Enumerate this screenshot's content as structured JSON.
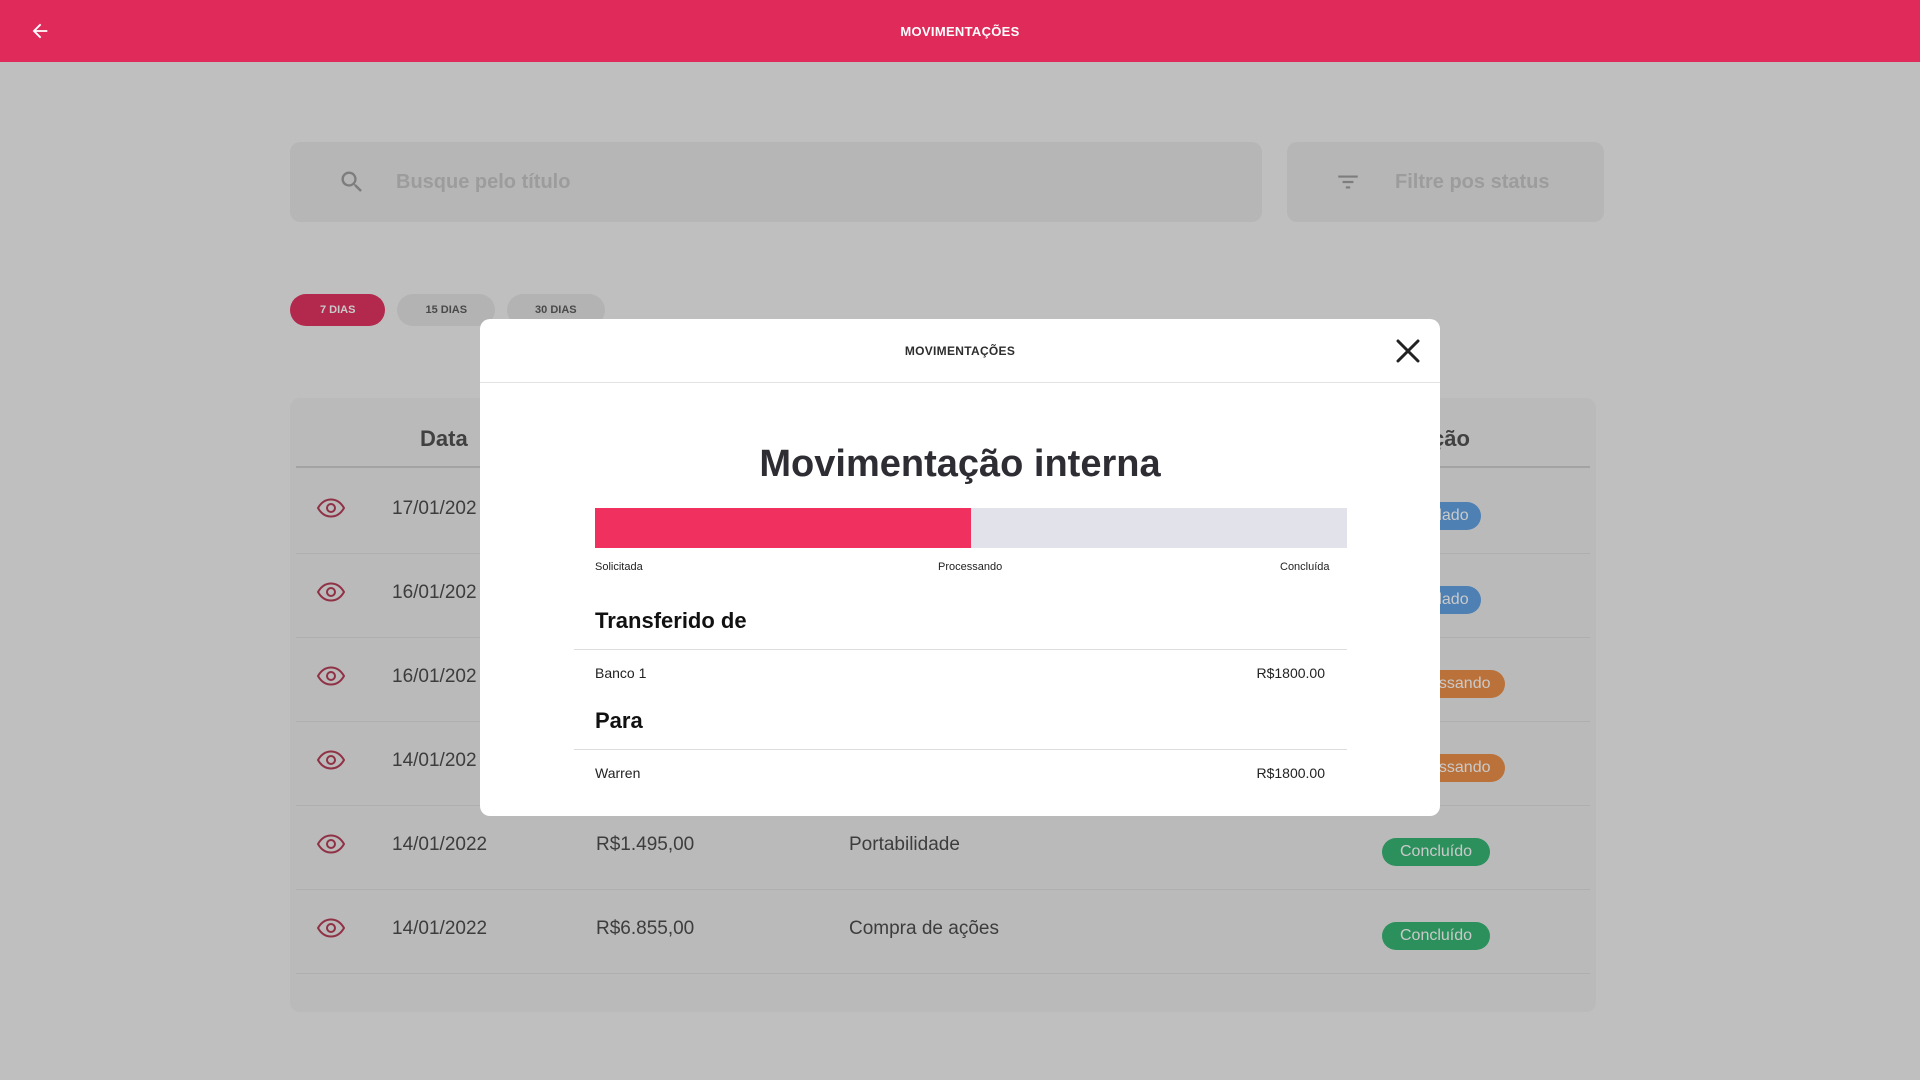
{
  "header": {
    "title": "MOVIMENTAÇÕES"
  },
  "search": {
    "placeholder": "Busque pelo título"
  },
  "status_filter": {
    "placeholder": "Filtre pos status"
  },
  "period_chips": [
    {
      "label": "7 DIAS",
      "active": true
    },
    {
      "label": "15 DIAS",
      "active": false
    },
    {
      "label": "30 DIAS",
      "active": false
    }
  ],
  "table": {
    "headers": {
      "date": "Data",
      "status": "ção"
    },
    "rows": [
      {
        "date": "17/01/202",
        "status": "dado",
        "status_color": "#5b9ee2"
      },
      {
        "date": "16/01/202",
        "status": "dado",
        "status_color": "#5b9ee2"
      },
      {
        "date": "16/01/202",
        "status": "essando",
        "status_color": "#ec8a40"
      },
      {
        "date": "14/01/202",
        "status": "essando",
        "status_color": "#ec8a40"
      },
      {
        "date": "14/01/2022",
        "value": "R$1.495,00",
        "description": "Portabilidade",
        "status": "Concluído",
        "status_color": "#2db36e"
      },
      {
        "date": "14/01/2022",
        "value": "R$6.855,00",
        "description": "Compra de ações",
        "status": "Concluído",
        "status_color": "#2db36e"
      }
    ]
  },
  "modal": {
    "header": "MOVIMENTAÇÕES",
    "title": "Movimentação interna",
    "progress": {
      "percent": 50,
      "color": "#f0305f"
    },
    "steps": [
      "Solicitada",
      "Processando",
      "Concluída"
    ],
    "from": {
      "title": "Transferido de",
      "name": "Banco 1",
      "amount": "R$1800.00"
    },
    "to": {
      "title": "Para",
      "name": "Warren",
      "amount": "R$1800.00"
    }
  },
  "icons": {
    "back": "arrow-left-icon",
    "search": "search-icon",
    "filter": "filter-icon",
    "view": "eye-icon",
    "close": "close-icon"
  },
  "colors": {
    "brand": "#e02a5a"
  }
}
